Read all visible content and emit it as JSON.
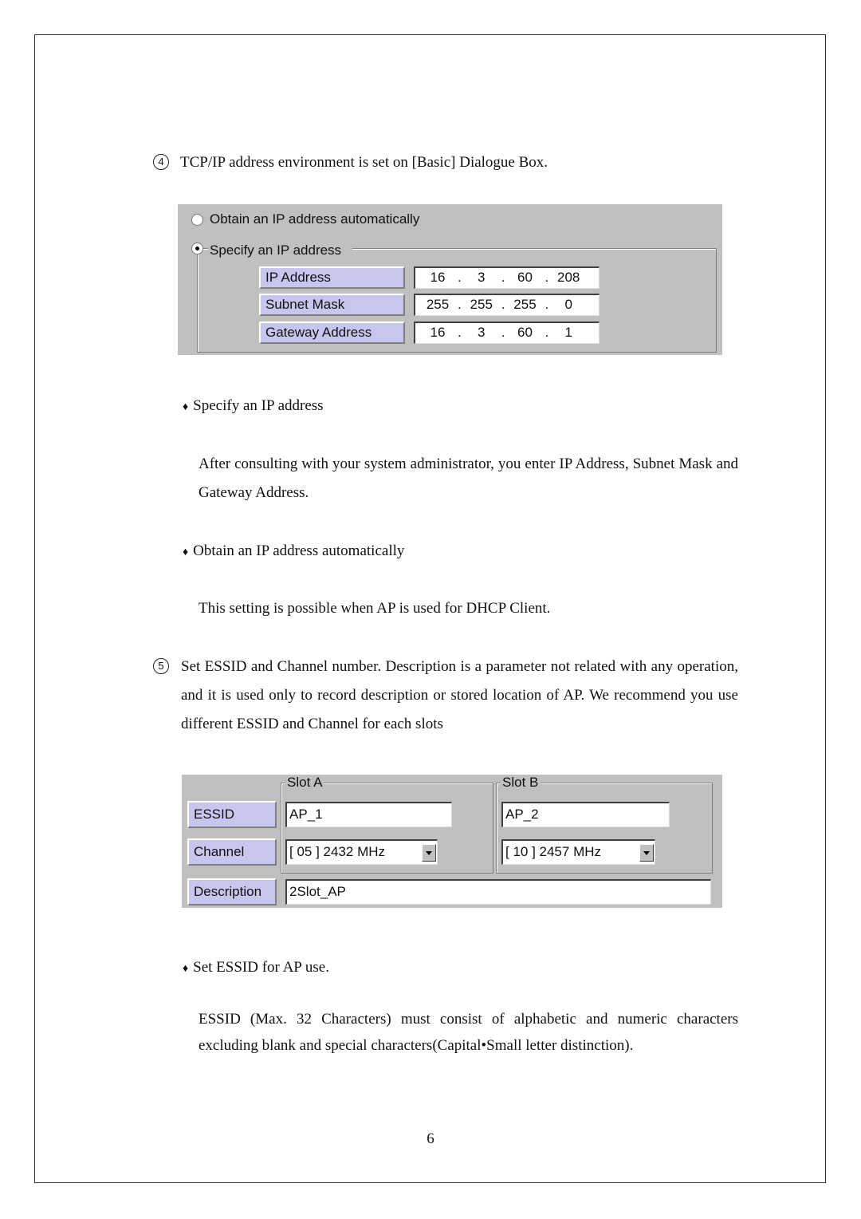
{
  "step4": {
    "number": "4",
    "text": "TCP/IP address environment is set on [Basic] Dialogue Box."
  },
  "ip_dialog": {
    "radio_auto": "Obtain an IP address automatically",
    "radio_specify": "Specify an IP address",
    "selected": "specify",
    "fields": [
      {
        "label": "IP Address",
        "octets": [
          "16",
          "3",
          "60",
          "208"
        ]
      },
      {
        "label": "Subnet Mask",
        "octets": [
          "255",
          "255",
          "255",
          "0"
        ]
      },
      {
        "label": "Gateway Address",
        "octets": [
          "16",
          "3",
          "60",
          "1"
        ]
      }
    ]
  },
  "bullets1": [
    {
      "title": "Specify an IP address",
      "body": "After consulting with your system administrator, you enter IP Address, Subnet Mask and Gateway Address."
    },
    {
      "title": "Obtain an IP address automatically",
      "body": "This setting is possible when AP is used for DHCP Client."
    }
  ],
  "step5": {
    "number": "5",
    "text": "Set ESSID and Channel number. Description is a parameter not related with any operation, and it is used only to record description or stored location of AP. We recommend you use different ESSID and Channel for each slots"
  },
  "slot_dialog": {
    "labels": {
      "essid": "ESSID",
      "channel": "Channel",
      "description": "Description"
    },
    "slot_a": {
      "title": "Slot A",
      "essid": "AP_1",
      "channel": "[ 05 ] 2432 MHz"
    },
    "slot_b": {
      "title": "Slot B",
      "essid": "AP_2",
      "channel": "[ 10 ] 2457 MHz"
    },
    "description": "2Slot_AP"
  },
  "bullets2": [
    {
      "title": "Set ESSID for AP use.",
      "body": "ESSID (Max. 32 Characters) must consist of alphabetic and numeric characters excluding blank and special characters(Capital•Small letter distinction)."
    }
  ],
  "page_number": "6"
}
